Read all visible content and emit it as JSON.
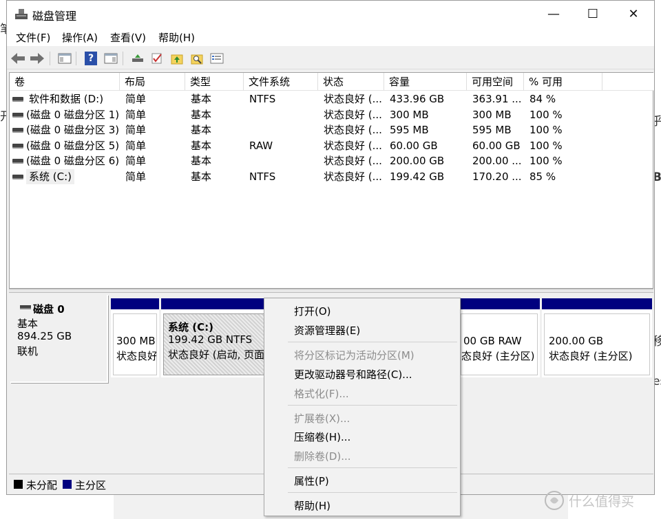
{
  "background": {
    "left_fragment_1": "笔",
    "left_fragment_2": "开",
    "right_fragment_1": "乎",
    "right_fragment_2": "B",
    "right_fragment_3": "移",
    "right_fragment_4": "es"
  },
  "window": {
    "title": "磁盘管理",
    "buttons": {
      "minimize": "—",
      "maximize": "☐",
      "close": "✕"
    }
  },
  "menu": [
    "文件(F)",
    "操作(A)",
    "查看(V)",
    "帮助(H)"
  ],
  "toolbar": {
    "icons": [
      "back-arrow-icon",
      "forward-arrow-icon",
      "properties-pane-icon",
      "help-icon",
      "action-pane-icon",
      "connect-drive-icon",
      "check-icon",
      "folder-up-icon",
      "folder-search-icon",
      "list-view-icon"
    ],
    "help_glyph": "?"
  },
  "volume_list": {
    "columns": [
      "卷",
      "布局",
      "类型",
      "文件系统",
      "状态",
      "容量",
      "可用空间",
      "% 可用"
    ],
    "rows": [
      {
        "volume": "软件和数据 (D:)",
        "layout": "简单",
        "type": "基本",
        "fs": "NTFS",
        "status": "状态良好 (...",
        "capacity": "433.96 GB",
        "free": "363.91 ...",
        "pct": "84 %"
      },
      {
        "volume": "(磁盘 0 磁盘分区 1)",
        "layout": "简单",
        "type": "基本",
        "fs": "",
        "status": "状态良好 (...",
        "capacity": "300 MB",
        "free": "300 MB",
        "pct": "100 %"
      },
      {
        "volume": "(磁盘 0 磁盘分区 3)",
        "layout": "简单",
        "type": "基本",
        "fs": "",
        "status": "状态良好 (...",
        "capacity": "595 MB",
        "free": "595 MB",
        "pct": "100 %"
      },
      {
        "volume": "(磁盘 0 磁盘分区 5)",
        "layout": "简单",
        "type": "基本",
        "fs": "RAW",
        "status": "状态良好 (...",
        "capacity": "60.00 GB",
        "free": "60.00 GB",
        "pct": "100 %"
      },
      {
        "volume": "(磁盘 0 磁盘分区 6)",
        "layout": "简单",
        "type": "基本",
        "fs": "",
        "status": "状态良好 (...",
        "capacity": "200.00 GB",
        "free": "200.00 ...",
        "pct": "100 %"
      },
      {
        "volume": "系统 (C:)",
        "layout": "简单",
        "type": "基本",
        "fs": "NTFS",
        "status": "状态良好 (...",
        "capacity": "199.42 GB",
        "free": "170.20 ...",
        "pct": "85 %"
      }
    ]
  },
  "disk": {
    "name": "磁盘 0",
    "type": "基本",
    "size": "894.25 GB",
    "status": "联机",
    "partitions": [
      {
        "line1": "",
        "line2": "300 MB",
        "line3": "状态良好"
      },
      {
        "line1": "系统 (C:)",
        "line2": "199.42 GB NTFS",
        "line3": "状态良好 (启动, 页面)"
      },
      {
        "line1": "",
        "line2": "00 GB RAW",
        "line3": "态良好 (主分区)"
      },
      {
        "line1": "",
        "line2": "200.00 GB",
        "line3": "状态良好 (主分区)"
      }
    ]
  },
  "legend": [
    {
      "label": "未分配",
      "color": "#000000"
    },
    {
      "label": "主分区",
      "color": "#00007f"
    }
  ],
  "context_menu": {
    "items": [
      {
        "label": "打开(O)",
        "enabled": true
      },
      {
        "label": "资源管理器(E)",
        "enabled": true
      },
      {
        "label": "将分区标记为活动分区(M)",
        "enabled": false
      },
      {
        "label": "更改驱动器号和路径(C)...",
        "enabled": true
      },
      {
        "label": "格式化(F)...",
        "enabled": false
      },
      {
        "label": "扩展卷(X)...",
        "enabled": false
      },
      {
        "label": "压缩卷(H)...",
        "enabled": true
      },
      {
        "label": "删除卷(D)...",
        "enabled": false
      },
      {
        "label": "属性(P)",
        "enabled": true
      },
      {
        "label": "帮助(H)",
        "enabled": true
      }
    ]
  },
  "watermark": {
    "text": "什么值得买",
    "icon": "smzdm-logo-icon"
  }
}
